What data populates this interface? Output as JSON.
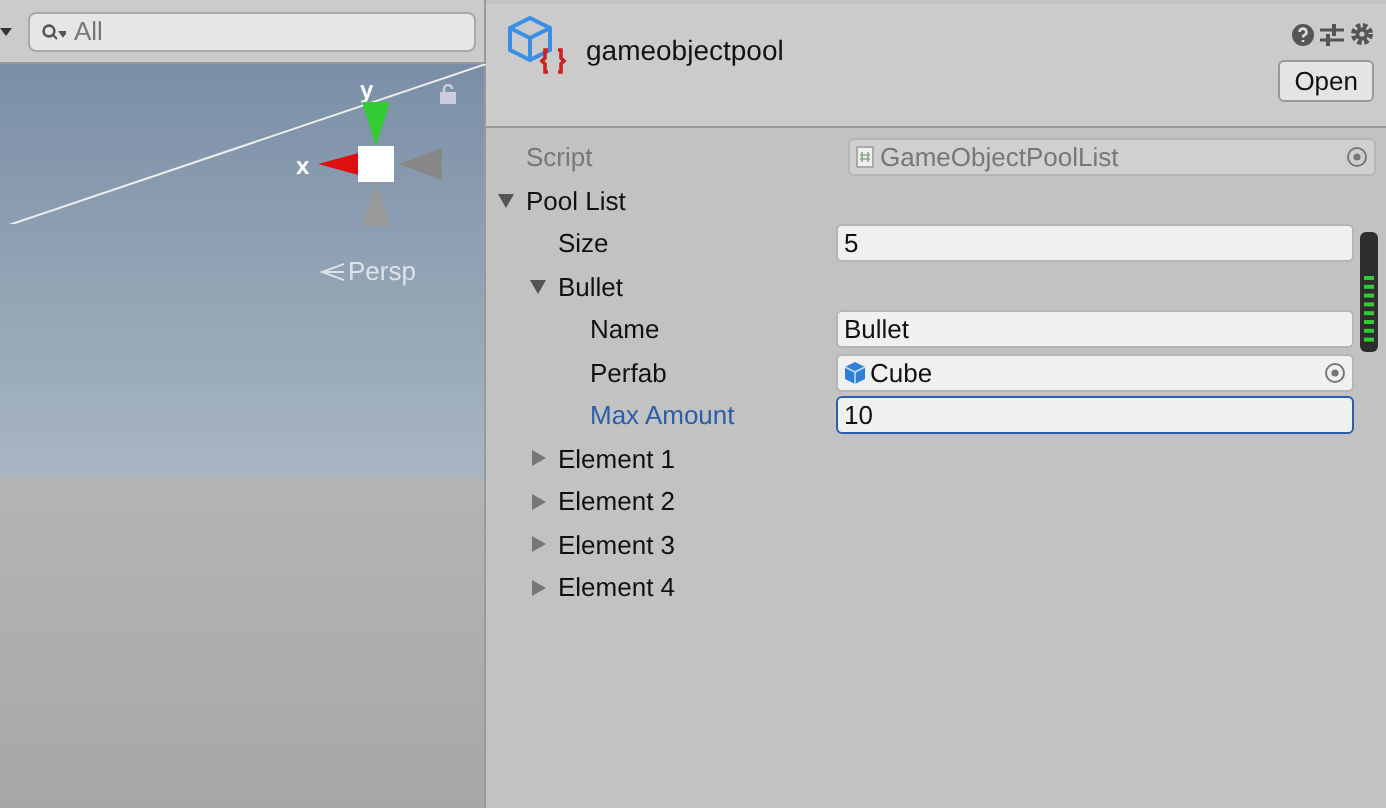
{
  "scene_toolbar": {
    "search": {
      "placeholder": "All"
    }
  },
  "scene": {
    "gizmo_axes": [
      {
        "label": "y"
      },
      {
        "label": "x"
      }
    ],
    "projection": "Persp"
  },
  "inspector": {
    "title": "gameobjectpool",
    "open_button": "Open",
    "script": {
      "label": "Script",
      "value": "GameObjectPoolList",
      "disabled": true
    },
    "properties": [
      {
        "kind": "foldout",
        "label": "Pool List",
        "expanded": true,
        "children": [
          {
            "kind": "text",
            "label": "Size",
            "value": "5",
            "focused": false
          },
          {
            "kind": "foldout",
            "label": "Bullet",
            "expanded": true,
            "children": [
              {
                "kind": "text",
                "label": "Name",
                "value": "Bullet",
                "focused": false
              },
              {
                "kind": "object",
                "label": "Perfab",
                "value": "Cube",
                "focused": false
              },
              {
                "kind": "text",
                "label": "Max Amount",
                "value": "10",
                "focused": true
              }
            ]
          },
          {
            "kind": "foldout",
            "label": "Element 1",
            "expanded": false
          },
          {
            "kind": "foldout",
            "label": "Element 2",
            "expanded": false
          },
          {
            "kind": "foldout",
            "label": "Element 3",
            "expanded": false
          },
          {
            "kind": "foldout",
            "label": "Element 4",
            "expanded": false
          }
        ]
      }
    ]
  }
}
